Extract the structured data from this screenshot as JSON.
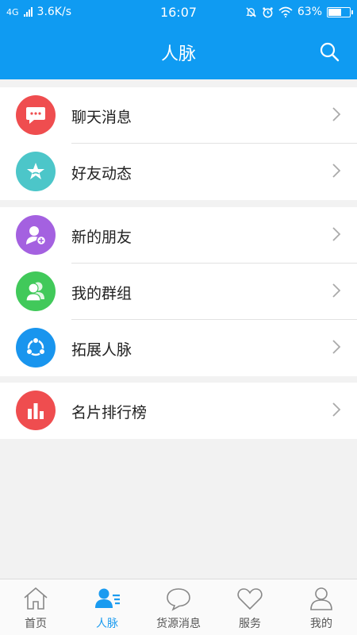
{
  "status_bar": {
    "network": "4G",
    "speed": "3.6K/s",
    "time": "16:07",
    "battery": "63%",
    "battery_level": 0.63
  },
  "header": {
    "title": "人脉",
    "search_icon": "search-icon"
  },
  "groups": [
    [
      {
        "label": "聊天消息",
        "icon": "chat-bubble-icon",
        "color": "#ef4d4f"
      },
      {
        "label": "好友动态",
        "icon": "star-icon",
        "color": "#4cc6c9"
      }
    ],
    [
      {
        "label": "新的朋友",
        "icon": "add-friend-icon",
        "color": "#a461e0"
      },
      {
        "label": "我的群组",
        "icon": "group-icon",
        "color": "#41c95a"
      },
      {
        "label": "拓展人脉",
        "icon": "share-network-icon",
        "color": "#1995ee"
      }
    ],
    [
      {
        "label": "名片排行榜",
        "icon": "bar-chart-icon",
        "color": "#ef4d4f"
      }
    ]
  ],
  "tabs": [
    {
      "label": "首页",
      "icon": "home-icon"
    },
    {
      "label": "人脉",
      "icon": "contacts-icon",
      "active": true
    },
    {
      "label": "货源消息",
      "icon": "message-icon"
    },
    {
      "label": "服务",
      "icon": "heart-icon"
    },
    {
      "label": "我的",
      "icon": "profile-icon"
    }
  ],
  "colors": {
    "accent": "#0f9bf2",
    "active_tab": "#1a9bf0"
  }
}
